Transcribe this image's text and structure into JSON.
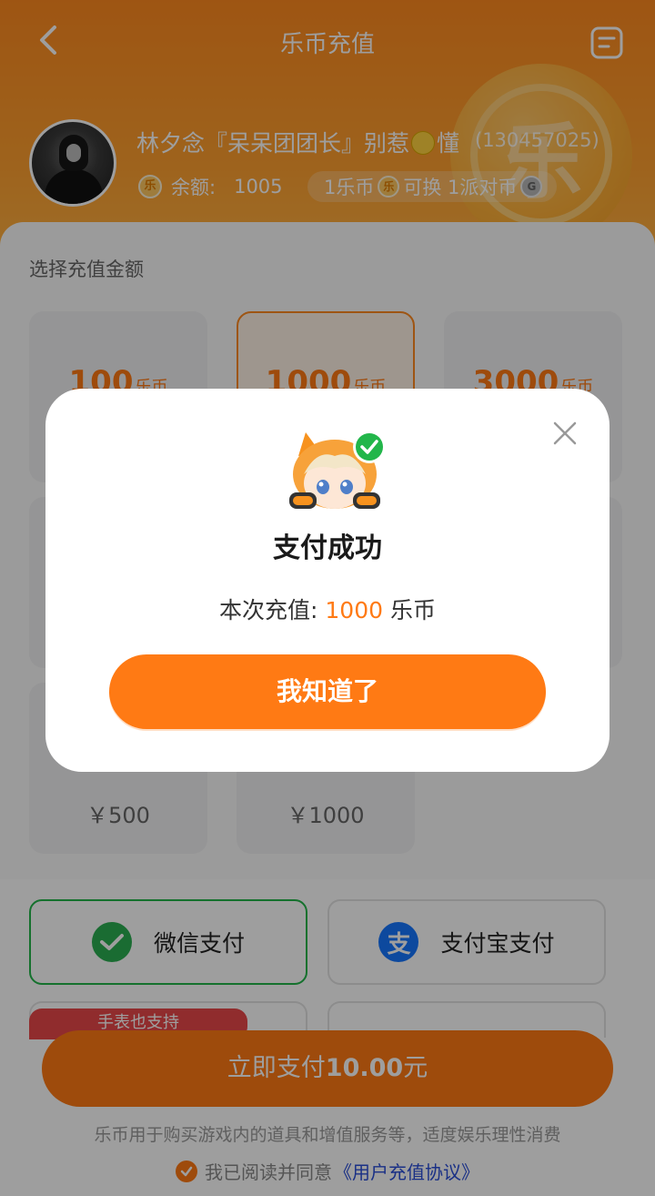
{
  "nav": {
    "title": "乐币充值"
  },
  "user": {
    "name_part1": "林夕念『呆呆团团长』别惹",
    "name_part2": "懂",
    "id": "(130457025)",
    "balance_label": "余额:",
    "balance_value": "1005",
    "coin_glyph": "乐"
  },
  "exchange": {
    "part1": "1乐币",
    "part2": "可换 1派对币",
    "party_glyph": "G"
  },
  "recharge": {
    "section_title": "选择充值金额",
    "tiles": [
      {
        "amount": "100",
        "unit": "乐币",
        "price": ""
      },
      {
        "amount": "1000",
        "unit": "乐币",
        "price": "",
        "selected": true
      },
      {
        "amount": "3000",
        "unit": "乐币",
        "price": ""
      },
      {
        "amount": "",
        "unit": "",
        "price": ""
      },
      {
        "amount": "",
        "unit": "",
        "price": ""
      },
      {
        "amount": "",
        "unit": "",
        "price": ""
      },
      {
        "amount": "",
        "unit": "",
        "price": "￥500"
      },
      {
        "amount": "",
        "unit": "",
        "price": "￥1000"
      }
    ]
  },
  "payment": {
    "wechat_label": "微信支付",
    "alipay_label": "支付宝支付",
    "alipay_glyph": "支",
    "watch_tag": "手表也支持",
    "pay_now_prefix": "立即支付",
    "pay_now_amount": "10.00",
    "pay_now_suffix": "元",
    "disclaimer": "乐币用于购买游戏内的道具和增值服务等，适度娱乐理性消费",
    "agree_text": "我已阅读并同意",
    "agree_link": "《用户充值协议》"
  },
  "modal": {
    "title": "支付成功",
    "recharge_label": "本次充值:",
    "recharge_amount": "1000",
    "recharge_unit": "乐币",
    "ok_button": "我知道了"
  },
  "colors": {
    "accent": "#ff7a14",
    "header": "#ff8a1f",
    "wechat": "#2aae51",
    "alipay": "#1677ff",
    "success": "#22b64a"
  }
}
